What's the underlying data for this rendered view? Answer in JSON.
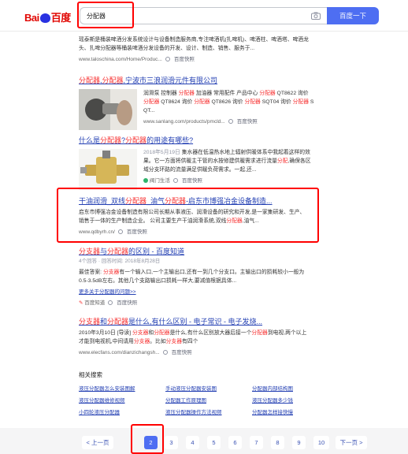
{
  "search": {
    "logo_left": "Bai",
    "logo_right": "百度",
    "query": "分配器",
    "button_label": "百度一下"
  },
  "results": [
    {
      "abstract": "瑶泰斯是桶装啤酒分发系统设计与设备制造服务商,专注啤酒机(扎啤机)、啤酒柱、啤酒塔、啤酒龙头、扎啤分配器等桶装啤酒分发设备的开发、设计、制造、销售、服务于...",
      "url": "www.taloschina.com/Home/Produc...",
      "snapshot": "百度快照"
    },
    {
      "title_parts": [
        "分配器",
        ",",
        "分配器",
        ",宁波市三浪润滑元件有限公司"
      ],
      "abstract_lines": [
        [
          "润滑泵 控制器 ",
          "分配器",
          " 加油器 常用配件 产品中心 ",
          "分配器",
          " QT8622 询价"
        ],
        [
          "分配器",
          " QT8624 询价 ",
          "分配器",
          " QT8626 询价 ",
          "分配器",
          " SQT04 询价 ",
          "分配器",
          " S"
        ],
        [
          "QT..."
        ]
      ],
      "url": "www.sanlang.com/products/pmcld...",
      "snapshot": "百度快照"
    },
    {
      "title_parts": [
        "什么是",
        "分配器",
        "?",
        "分配器",
        "的用途有哪些?"
      ],
      "date": "2018年5月19日",
      "abstract_lines": [
        [
          "集水器在低温热水地上辐射供暖体系中我起着这样的效"
        ],
        [
          "果。它一方面将供暖主干管的水按修建供暖需求进行流量",
          "分配",
          ",确保各区"
        ],
        [
          "域分支环路的流量满足供暖负荷需求。一起,还..."
        ]
      ],
      "source": "阀门生活",
      "snapshot": "百度快照"
    },
    {
      "title_parts": [
        "干油润滑_双线",
        "分配器",
        "_油气",
        "分配器",
        "-启东市博强冶金设备制造..."
      ],
      "abstract_lines": [
        [
          "启东市博强冶金设备制造有限公司长期从事液压、润滑设备的研究和开发,是一家集研发、生产、"
        ],
        [
          "销售于一体的生产制造企业。 公司主要生产干油润滑系统,双线",
          "分配器",
          ",油气..."
        ]
      ],
      "url": "www.qdbyrh.cn/",
      "snapshot": "百度快照"
    },
    {
      "title_parts": [
        "分支器",
        "与",
        "分配器",
        "的区别 - 百度知道"
      ],
      "meta": "4个回答 · 回答时间: 2018年8月28日",
      "abstract_lines": [
        [
          "最佳答案: ",
          "分支器",
          "有一个输入口,一个主输出口,还有一到几个分支口。主输出口的损耗较小一般为"
        ],
        [
          "0.5-3.5dB左右。其他几个支路输出口损耗一样大,要减值根据具体..."
        ]
      ],
      "more": "更多关于分配器的问题>>",
      "source": "百度知道",
      "snapshot": "百度快照"
    },
    {
      "title_parts": [
        "分支器",
        "和",
        "分配器",
        "是什么,有什么区别 - 电子常识 - 电子发烧..."
      ],
      "abstract_lines": [
        [
          "2010年3月10日 [导读] ",
          "分支器",
          "和",
          "分配器",
          "是什么,有什么区别放大器后接一个",
          "分配器",
          "到电视,两个以上"
        ],
        [
          "才能到电视机,中间请用",
          "分支器",
          "。比如",
          "分支器",
          "有四个"
        ]
      ],
      "url": "www.elecfans.com/dianzichangsh...",
      "snapshot": "百度快照"
    }
  ],
  "related": {
    "title": "相关搜索",
    "items": [
      "液压分配器怎么安装图解",
      "手动液压分配器安装图",
      "分配器内部结构图",
      "液压分配器维修视频",
      "分配器工作原理图",
      "液压分配器多少钱",
      "小四轮液压分配器",
      "液压分配器操作方法视频",
      "分配器怎样接快慢"
    ]
  },
  "pager": {
    "prev": "< 上一页",
    "next": "下一页 >",
    "pages": [
      "2",
      "3",
      "4",
      "5",
      "6",
      "7",
      "8",
      "9",
      "10"
    ],
    "current": "2"
  }
}
